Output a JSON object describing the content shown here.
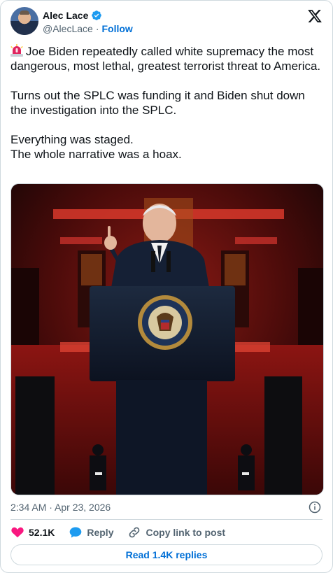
{
  "author": {
    "display_name": "Alec Lace",
    "handle": "@AlecLace",
    "separator": "·",
    "follow_label": "Follow"
  },
  "tweet": {
    "lines": [
      "Joe Biden repeatedly called white supremacy the most dangerous, most lethal, greatest terrorist threat to America.",
      "Turns out the SPLC was funding it and Biden shut down the investigation into the SPLC.",
      "Everything was staged.",
      "The whole narrative was a hoax."
    ],
    "leading_emoji": "siren-icon"
  },
  "photo": {
    "description_icon": "photo",
    "seal_text": "SEAL OF THE PRESIDENT OF THE UNITED STATES"
  },
  "footer": {
    "timestamp": "2:34 AM · Apr 23, 2026",
    "likes": "52.1K",
    "reply_label": "Reply",
    "copy_label": "Copy link to post",
    "read_replies_label": "Read 1.4K replies"
  },
  "colors": {
    "accent": "#006fd6",
    "like": "#f91880",
    "reply_icon": "#1d9bf0",
    "muted": "#536471",
    "border": "#cfd9de"
  }
}
